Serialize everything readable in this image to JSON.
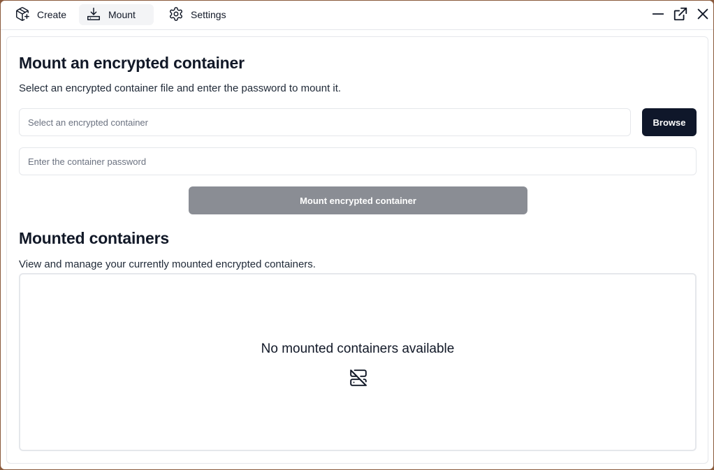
{
  "titlebar": {
    "tabs": [
      {
        "label": "Create",
        "icon": "package-plus-icon",
        "active": false
      },
      {
        "label": "Mount",
        "icon": "download-tray-icon",
        "active": true
      },
      {
        "label": "Settings",
        "icon": "gear-icon",
        "active": false
      }
    ],
    "controls": [
      "minimize-icon",
      "popout-icon",
      "close-icon"
    ]
  },
  "mount": {
    "title": "Mount an encrypted container",
    "description": "Select an encrypted container file and enter the password to mount it.",
    "container_placeholder": "Select an encrypted container",
    "container_value": "",
    "browse_label": "Browse",
    "password_placeholder": "Enter the container password",
    "password_value": "",
    "mount_button_label": "Mount encrypted container"
  },
  "mounted": {
    "title": "Mounted containers",
    "description": "View and manage your currently mounted encrypted containers.",
    "empty_message": "No mounted containers available",
    "empty_icon": "server-off-icon"
  },
  "colors": {
    "primary_button": "#0f172a",
    "disabled_button": "#8a8d94",
    "border": "#e5e7eb",
    "text": "#111827"
  }
}
